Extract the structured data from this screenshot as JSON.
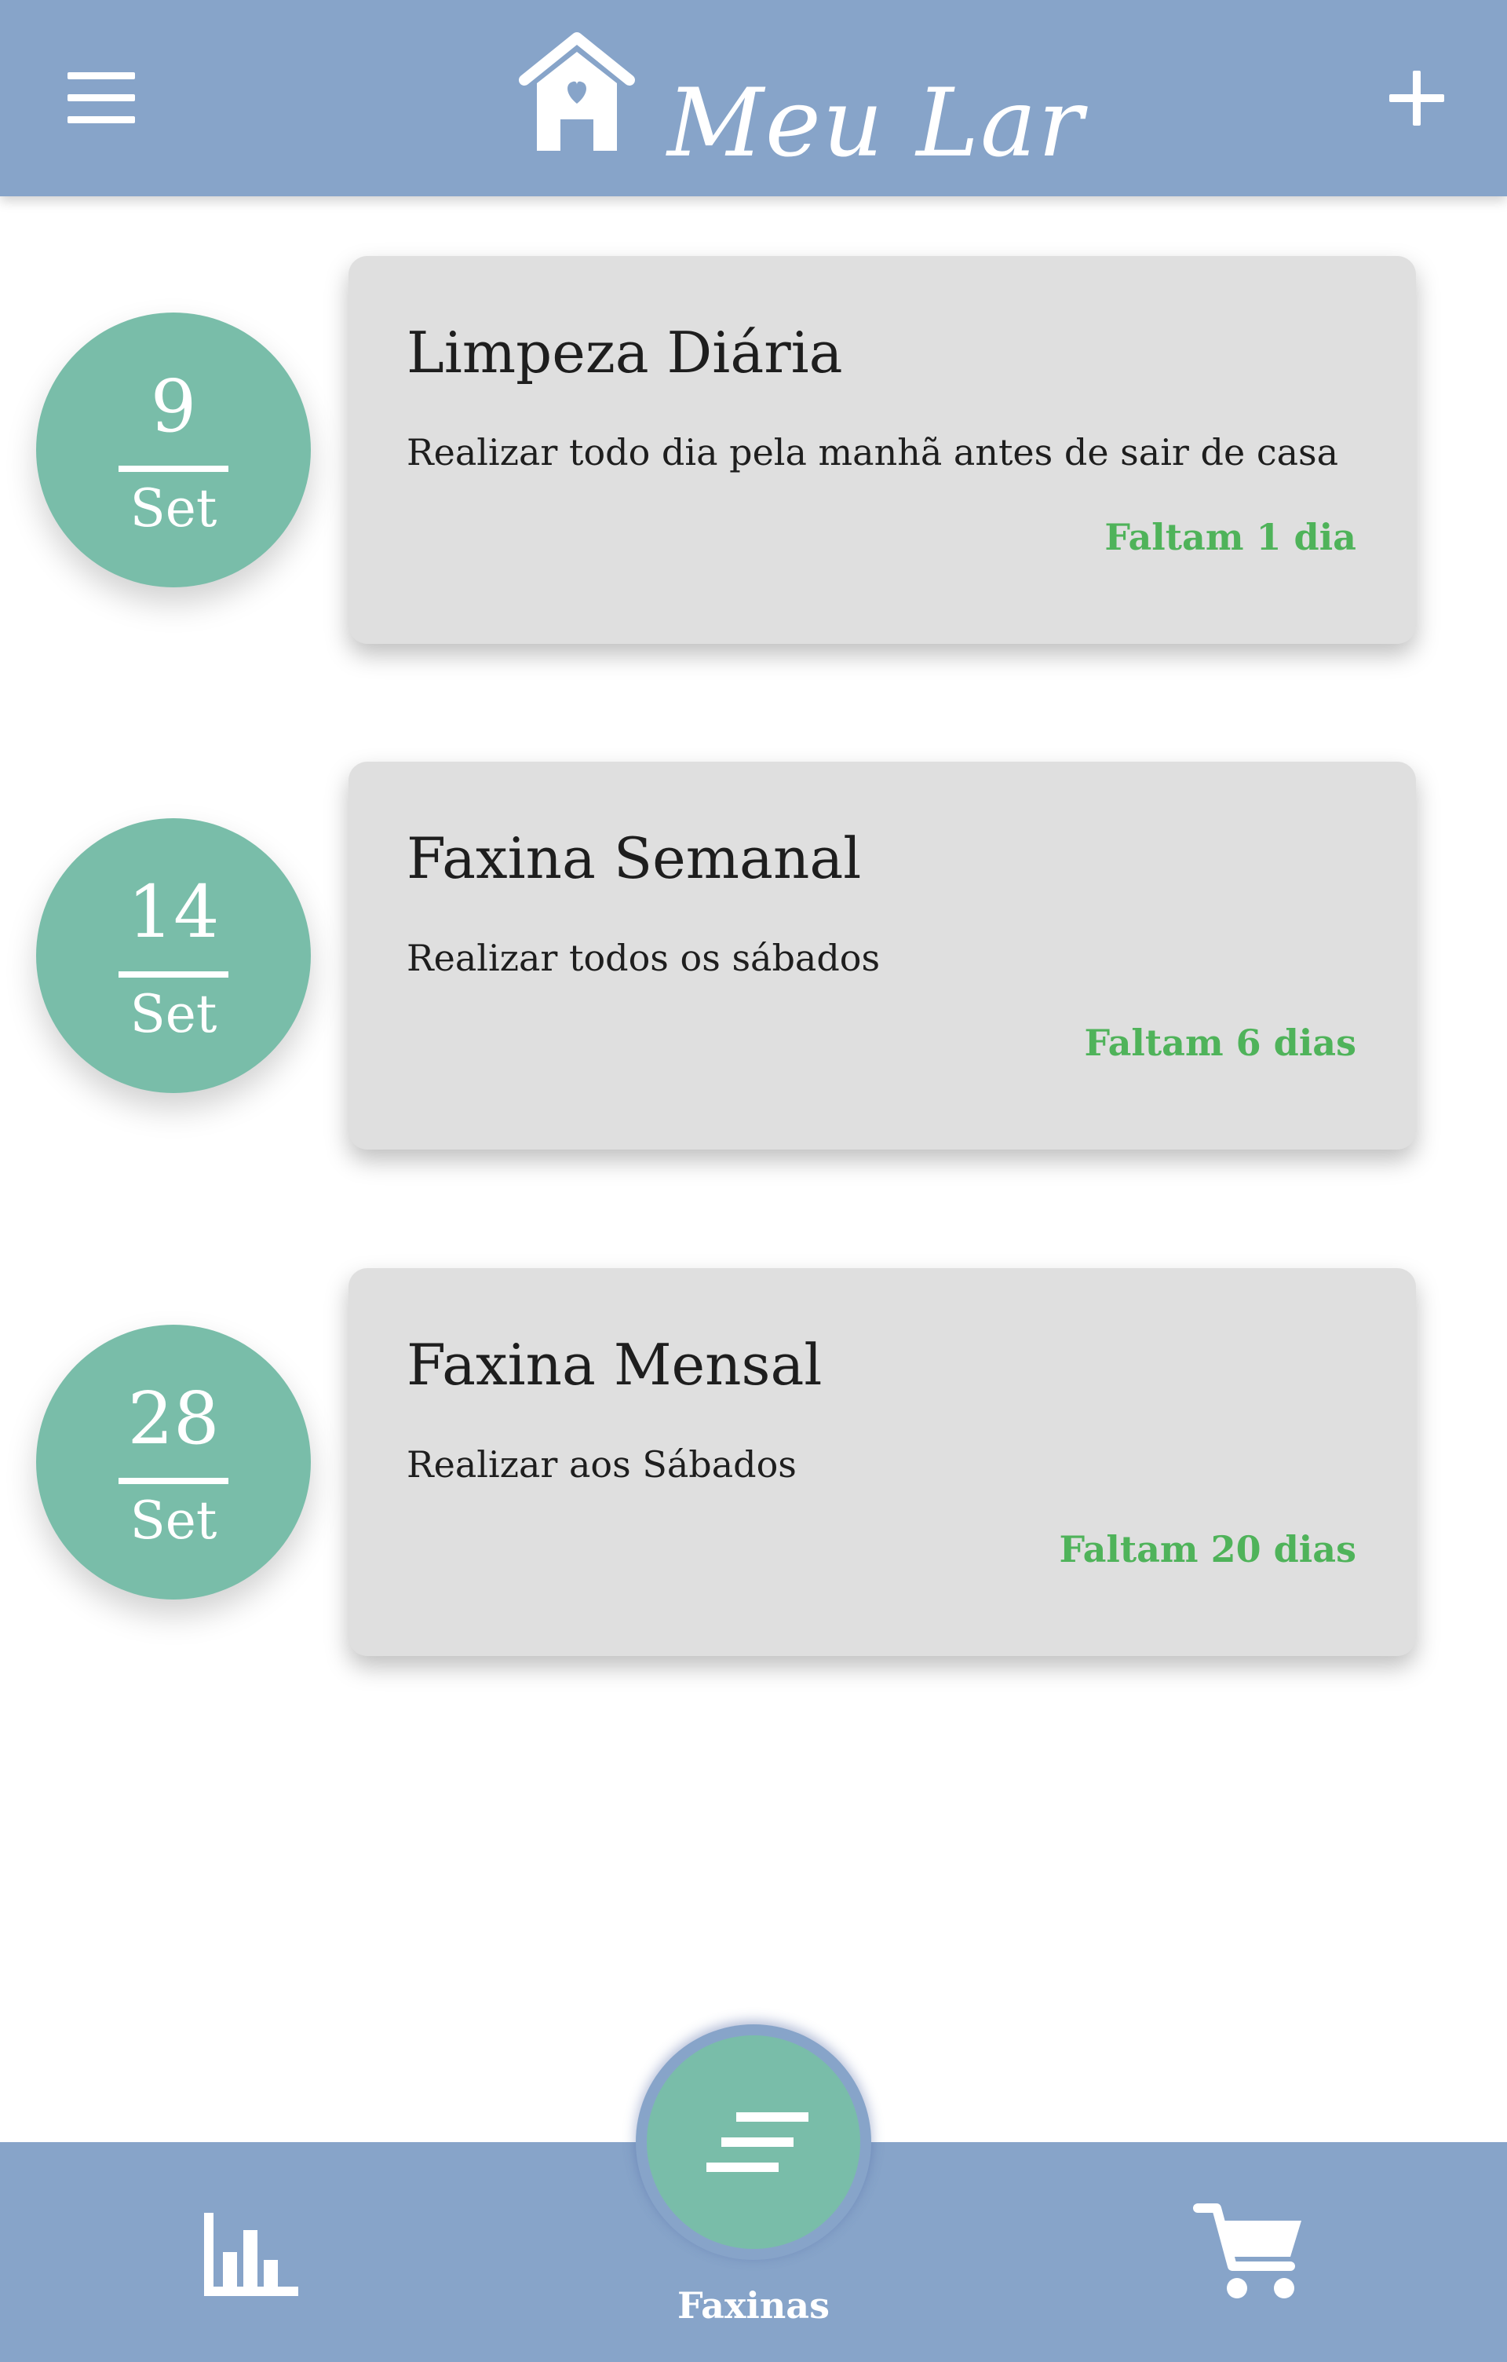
{
  "header": {
    "app_title": "Meu Lar",
    "menu_icon": "hamburger-menu-icon",
    "brand_icon": "house-heart-icon",
    "add_icon": "plus-icon"
  },
  "tasks": [
    {
      "date_day": "9",
      "date_month": "Set",
      "title": "Limpeza Diária",
      "description": "Realizar todo dia pela manhã antes de sair de casa",
      "remaining": "Faltam 1 dia"
    },
    {
      "date_day": "14",
      "date_month": "Set",
      "title": "Faxina Semanal",
      "description": "Realizar todos os sábados",
      "remaining": "Faltam 6 dias"
    },
    {
      "date_day": "28",
      "date_month": "Set",
      "title": "Faxina Mensal",
      "description": "Realizar aos Sábados",
      "remaining": "Faltam 20 dias"
    }
  ],
  "bottom_nav": {
    "active_label": "Faxinas",
    "left_icon": "bar-chart-icon",
    "center_icon": "list-lines-icon",
    "right_icon": "shopping-cart-icon"
  },
  "colors": {
    "header": "#87a4c9",
    "badge": "#79bda9",
    "card": "#dfdfdf",
    "remaining_text": "#4fb35a"
  }
}
